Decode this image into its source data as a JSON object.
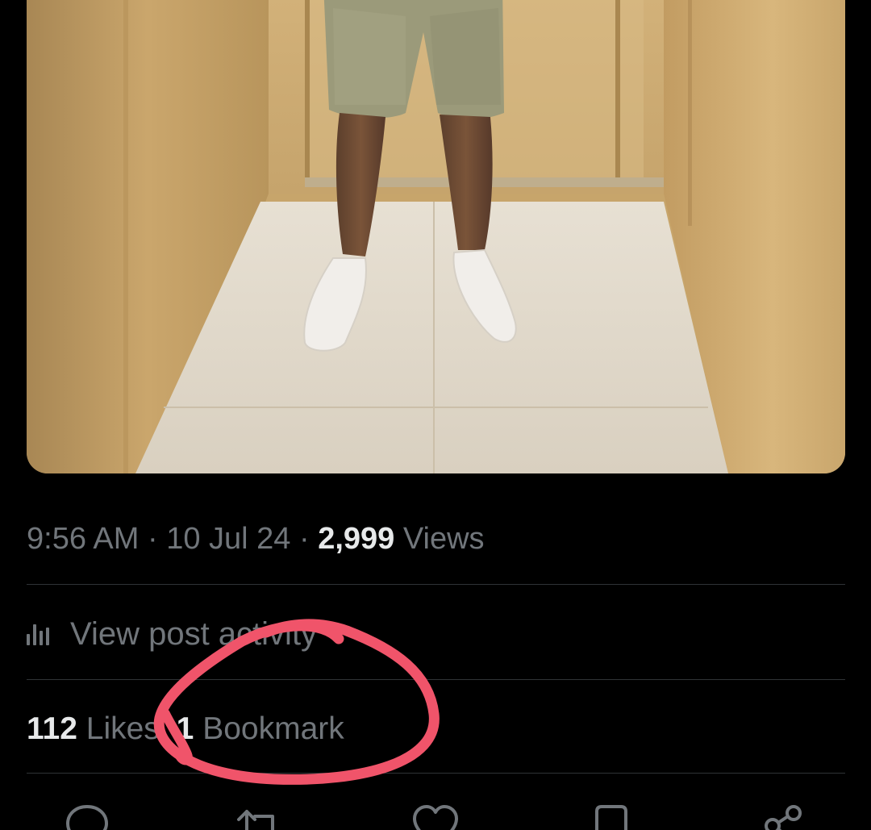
{
  "post": {
    "photo": {
      "subject": "man-in-khaki-shorts-and-white-sneakers-in-elevator"
    },
    "meta": {
      "time": "9:56 AM",
      "separator": "·",
      "date": "10 Jul 24",
      "views_count": "2,999",
      "views_label": "Views"
    },
    "activity": {
      "icon": "bar-chart-icon",
      "label": "View post activity"
    },
    "stats": {
      "likes_count": "112",
      "likes_label": "Likes",
      "bookmarks_count": "1",
      "bookmarks_label": "Bookmark"
    },
    "actions": [
      {
        "icon": "reply-icon"
      },
      {
        "icon": "repost-icon"
      },
      {
        "icon": "like-icon"
      },
      {
        "icon": "bookmark-icon"
      },
      {
        "icon": "share-icon"
      }
    ]
  },
  "annotation": {
    "type": "hand-drawn-circle",
    "color": "#f0546a"
  },
  "colors": {
    "background": "#000000",
    "primary_text": "#e7e9ea",
    "secondary_text": "#71767b",
    "divider": "#2f3336"
  }
}
